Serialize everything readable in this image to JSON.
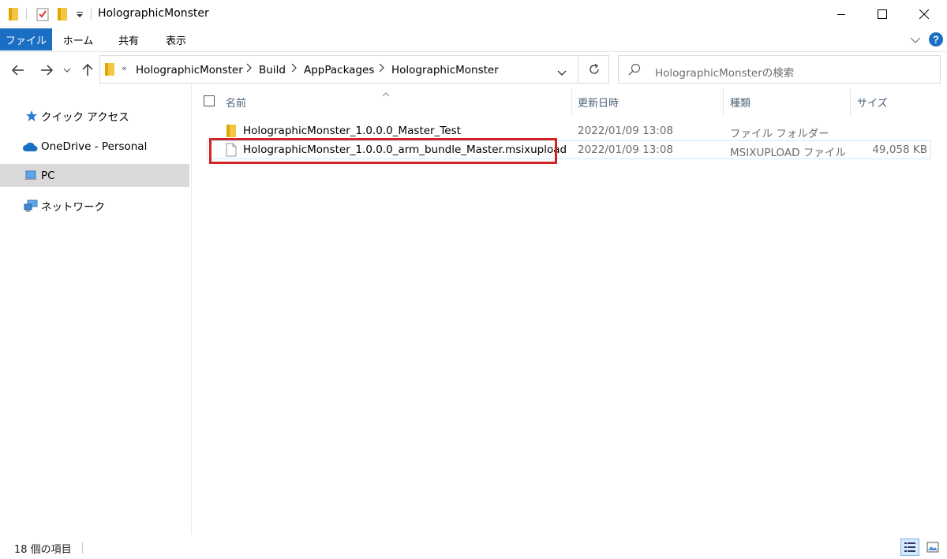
{
  "window": {
    "title": "HolographicMonster"
  },
  "ribbon": {
    "tabs": [
      {
        "label": "ファイル"
      },
      {
        "label": "ホーム"
      },
      {
        "label": "共有"
      },
      {
        "label": "表示"
      }
    ]
  },
  "address": {
    "overflow": "«",
    "crumbs": [
      "HolographicMonster",
      "Build",
      "AppPackages",
      "HolographicMonster"
    ]
  },
  "search": {
    "placeholder": "HolographicMonsterの検索"
  },
  "nav": {
    "items": [
      {
        "label": "クイック アクセス",
        "icon": "star-icon"
      },
      {
        "label": "OneDrive - Personal",
        "icon": "cloud-icon"
      },
      {
        "label": "PC",
        "icon": "computer-icon"
      },
      {
        "label": "ネットワーク",
        "icon": "network-icon"
      }
    ]
  },
  "columns": {
    "name": "名前",
    "date": "更新日時",
    "type": "種類",
    "size": "サイズ"
  },
  "files": [
    {
      "name": "HolographicMonster_1.0.0.0_Master_Test",
      "date": "2022/01/09 13:08",
      "type": "ファイル フォルダー",
      "size": "",
      "icon": "folder-icon"
    },
    {
      "name": "HolographicMonster_1.0.0.0_arm_bundle_Master.msixupload",
      "date": "2022/01/09 13:08",
      "type": "MSIXUPLOAD ファイル",
      "size": "49,058 KB",
      "icon": "file-icon"
    }
  ],
  "status": {
    "item_count": "18 個の項目"
  },
  "colors": {
    "accent": "#1a6ec3",
    "highlight_box": "#d32424"
  }
}
